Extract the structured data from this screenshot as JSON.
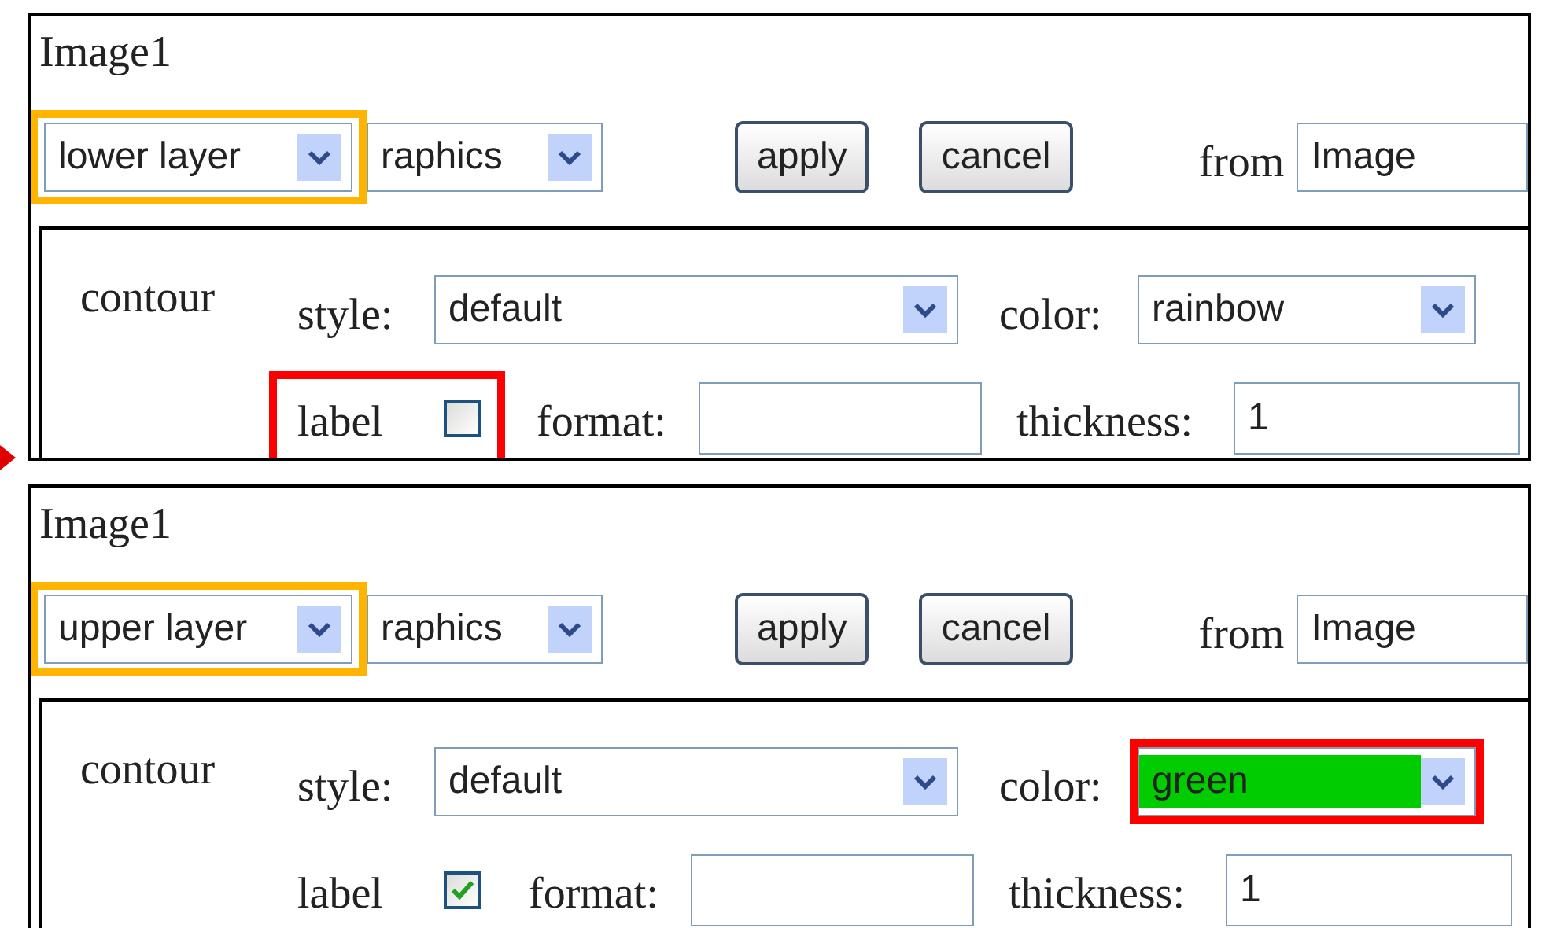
{
  "panels": [
    {
      "title": "Image1",
      "layer_select": {
        "value": "lower layer",
        "highlight": {
          "color": "#ffb400"
        }
      },
      "source_select": {
        "value": "raphics"
      },
      "buttons": [
        "apply",
        "cancel"
      ],
      "from": {
        "label": "from",
        "value": "Image"
      },
      "section": {
        "title": "contour",
        "style": {
          "label": "style:",
          "value": "default"
        },
        "color": {
          "label": "color:",
          "value": "rainbow"
        },
        "label": {
          "label": "label",
          "checked": false,
          "highlight": {
            "color": "#ff0000"
          }
        },
        "format": {
          "label": "format:"
        },
        "thickness": {
          "label": "thickness:",
          "value": "1"
        }
      }
    },
    {
      "title": "Image1",
      "layer_select": {
        "value": "upper layer",
        "highlight": {
          "color": "#ffb400"
        }
      },
      "source_select": {
        "value": "raphics"
      },
      "buttons": [
        "apply",
        "cancel"
      ],
      "from": {
        "label": "from",
        "value": "Image"
      },
      "section": {
        "title": "contour",
        "style": {
          "label": "style:",
          "value": "default"
        },
        "color": {
          "label": "color:",
          "value": "green",
          "swatch": {
            "color": "#00cc00"
          },
          "highlight": {
            "color": "#ff0000"
          }
        },
        "label": {
          "label": "label",
          "checked": true
        },
        "format": {
          "label": "format:"
        },
        "thickness": {
          "label": "thickness:",
          "value": "1"
        }
      }
    }
  ]
}
